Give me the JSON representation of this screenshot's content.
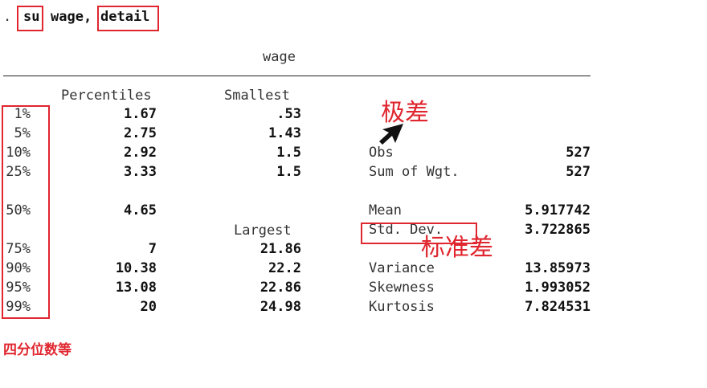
{
  "command": {
    "prompt": ".",
    "cmd": "su",
    "var": "wage,",
    "opt": "detail"
  },
  "title": "wage",
  "headers": {
    "percentiles": "Percentiles",
    "smallest": "Smallest",
    "largest": "Largest"
  },
  "rows": [
    {
      "pct": "1%",
      "val": "1.67",
      "ext": ".53",
      "label": "",
      "stat": ""
    },
    {
      "pct": "5%",
      "val": "2.75",
      "ext": "1.43",
      "label": "",
      "stat": ""
    },
    {
      "pct": "10%",
      "val": "2.92",
      "ext": "1.5",
      "label": "Obs",
      "stat": "527"
    },
    {
      "pct": "25%",
      "val": "3.33",
      "ext": "1.5",
      "label": "Sum of Wgt.",
      "stat": "527"
    },
    {
      "pct": "50%",
      "val": "4.65",
      "ext": "",
      "label": "Mean",
      "stat": "5.917742"
    },
    {
      "pct": "",
      "val": "",
      "ext": "",
      "label": "Std. Dev.",
      "stat": "3.722865"
    },
    {
      "pct": "75%",
      "val": "7",
      "ext": "21.86",
      "label": "",
      "stat": ""
    },
    {
      "pct": "90%",
      "val": "10.38",
      "ext": "22.2",
      "label": "Variance",
      "stat": "13.85973"
    },
    {
      "pct": "95%",
      "val": "13.08",
      "ext": "22.86",
      "label": "Skewness",
      "stat": "1.993052"
    },
    {
      "pct": "99%",
      "val": "20",
      "ext": "24.98",
      "label": "Kurtosis",
      "stat": "7.824531"
    }
  ],
  "annotations": {
    "range": "极差",
    "std": "标准差",
    "quantiles": "四分位数等"
  },
  "colors": {
    "annotation": "#e0262f"
  }
}
